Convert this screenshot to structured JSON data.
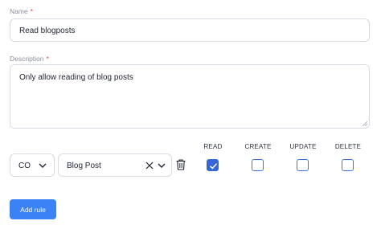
{
  "form": {
    "name": {
      "label": "Name",
      "required_mark": "*",
      "value": "Read blogposts"
    },
    "description": {
      "label": "Description",
      "required_mark": "*",
      "value": "Only allow reading of blog posts"
    }
  },
  "rule": {
    "action_select_value": "CO",
    "resource_select_value": "Blog Post",
    "permissions": [
      {
        "label": "READ",
        "checked": true
      },
      {
        "label": "CREATE",
        "checked": false
      },
      {
        "label": "UPDATE",
        "checked": false
      },
      {
        "label": "DELETE",
        "checked": false
      }
    ]
  },
  "buttons": {
    "add_rule": "Add rule"
  },
  "colors": {
    "accent": "#3b82f6",
    "checkbox_border": "#3b74e0",
    "required": "#e5484d"
  }
}
